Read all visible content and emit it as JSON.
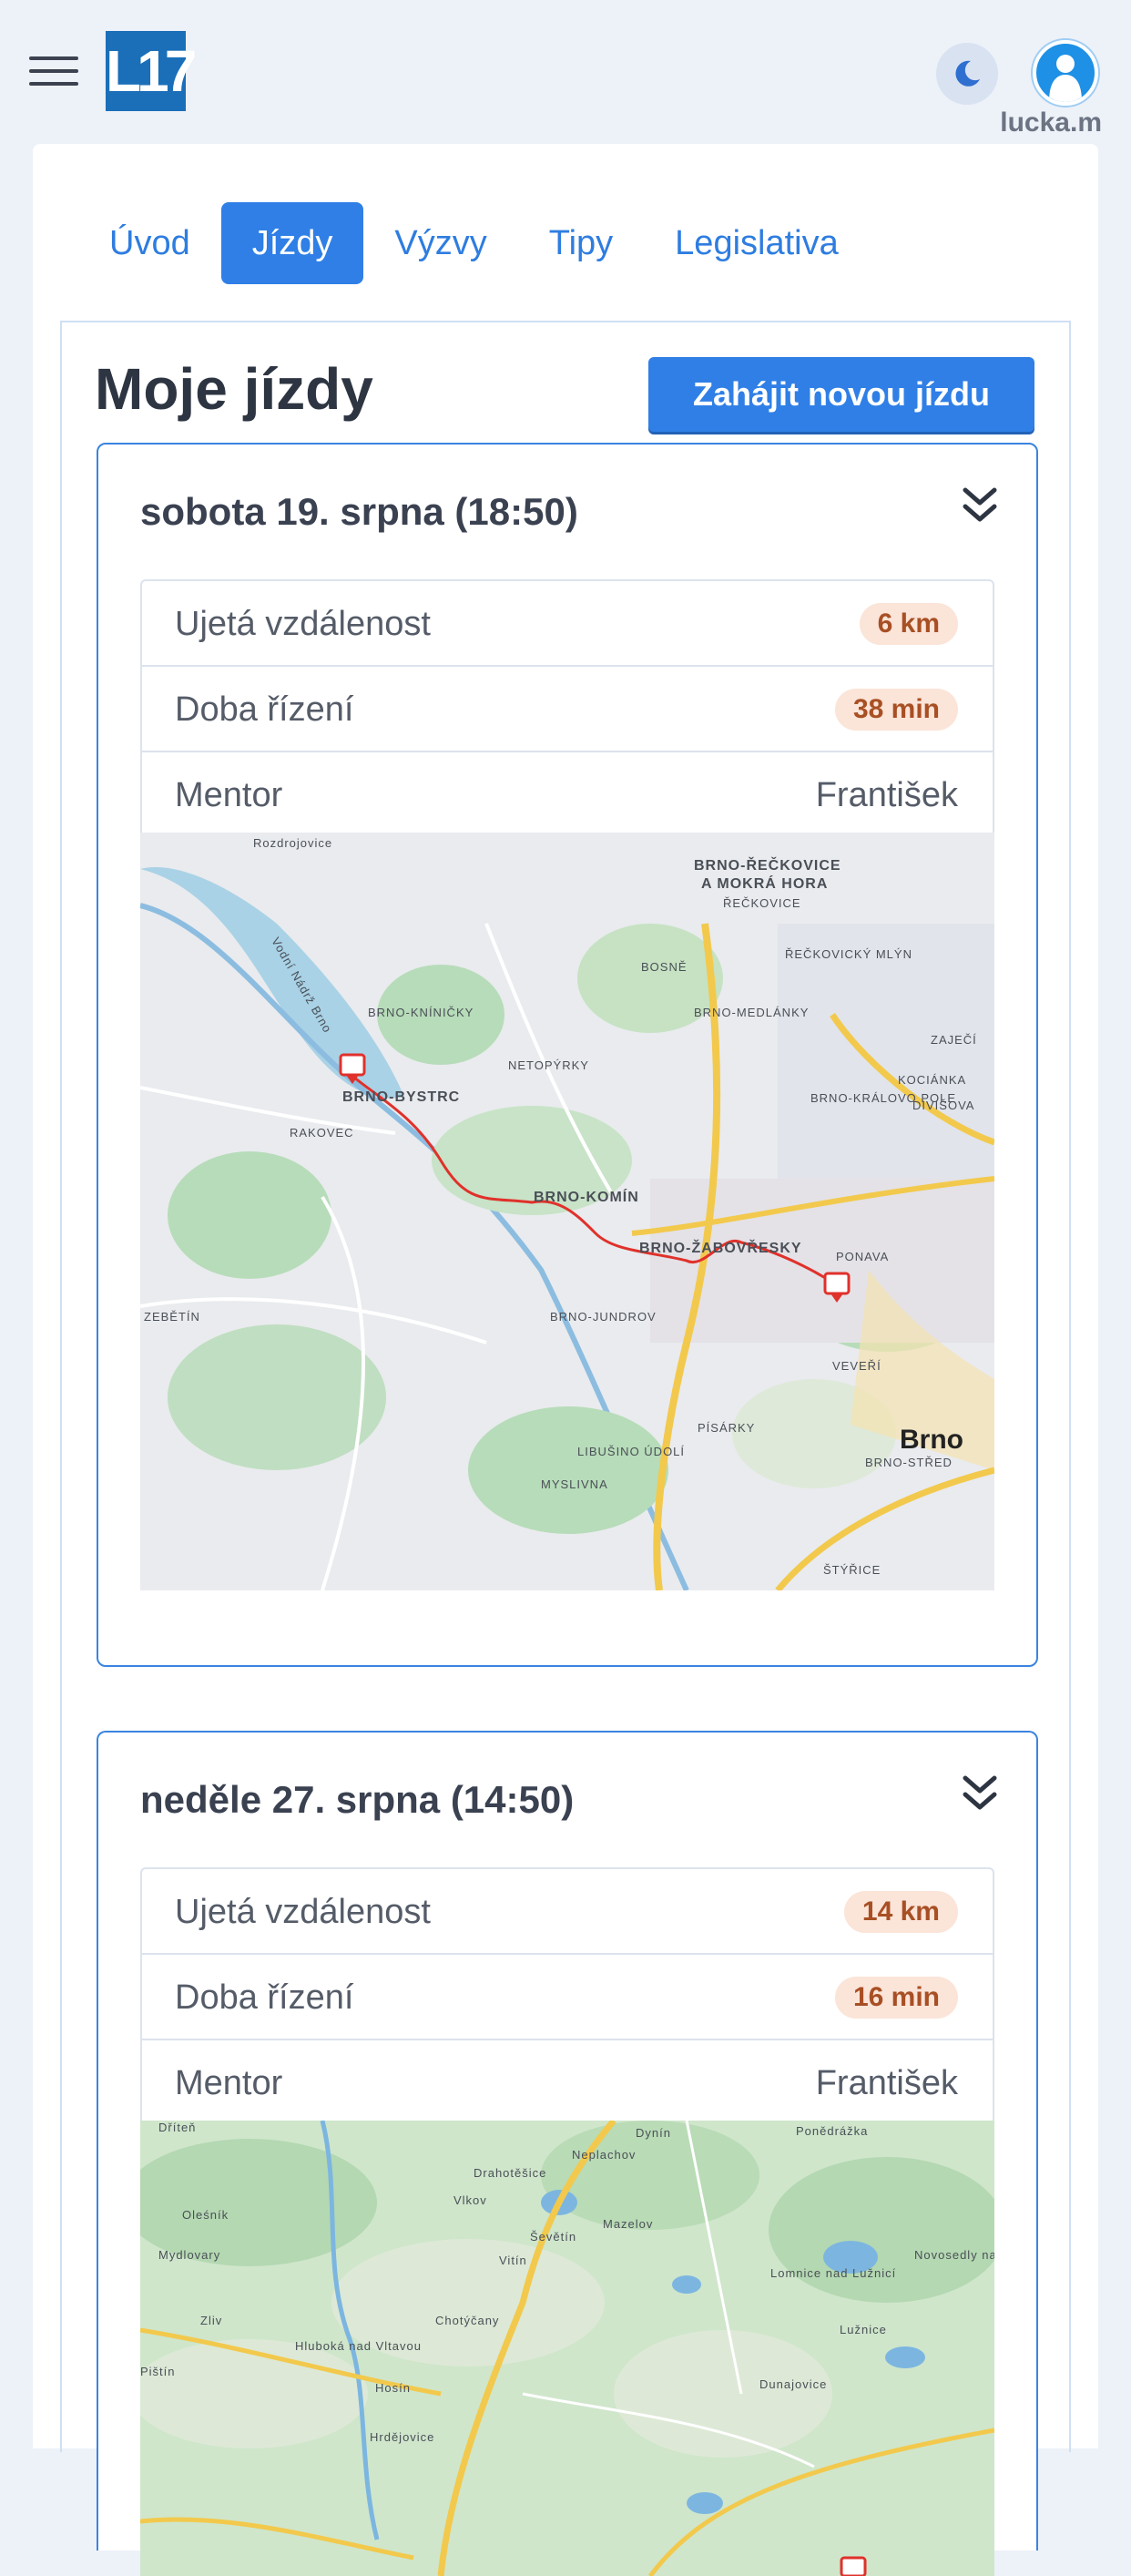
{
  "header": {
    "logo_text": "L17",
    "username": "lucka.m",
    "icons": [
      "menu-icon",
      "moon-icon",
      "user-icon"
    ]
  },
  "tabs": [
    {
      "label": "Úvod",
      "active": false
    },
    {
      "label": "Jízdy",
      "active": true
    },
    {
      "label": "Výzvy",
      "active": false
    },
    {
      "label": "Tipy",
      "active": false
    },
    {
      "label": "Legislativa",
      "active": false
    }
  ],
  "page": {
    "title": "Moje jízdy",
    "new_ride_button": "Zahájit novou jízdu"
  },
  "rides": [
    {
      "title": "sobota 19. srpna (18:50)",
      "distance_label": "Ujetá vzdálenost",
      "distance_value": "6 km",
      "duration_label": "Doba řízení",
      "duration_value": "38 min",
      "mentor_label": "Mentor",
      "mentor_value": "František",
      "map_labels": [
        "Rozdrojovice",
        "BRNO-ŘEČKOVICE",
        "A MOKRÁ HORA",
        "ŘEČKOVICE",
        "BOSNĚ",
        "ŘEČKOVICKÝ MLÝN",
        "BRNO-KNÍNIČKY",
        "BRNO-MEDLÁNKY",
        "ZAJEČÍ",
        "NETOPÝRKY",
        "KOCIÁNKA",
        "BRNO-KRÁLOVO POLE",
        "DIVIŠOVA",
        "BRNO-BYSTRC",
        "RAKOVEC",
        "BRNO-KOMÍN",
        "BRNO-ŽABOVŘESKY",
        "PONAVA",
        "ZEBĚTÍN",
        "BRNO-JUNDROV",
        "VEVEŘÍ",
        "PÍSÁRKY",
        "LIBUŠINO ÚDOLÍ",
        "Brno",
        "BRNO-STŘED",
        "MYSLIVNA",
        "ŠTÝŘICE",
        "Vodní Nádrž Brno"
      ]
    },
    {
      "title": "neděle 27. srpna (14:50)",
      "distance_label": "Ujetá vzdálenost",
      "distance_value": "14 km",
      "duration_label": "Doba řízení",
      "duration_value": "16 min",
      "mentor_label": "Mentor",
      "mentor_value": "František",
      "map_labels": [
        "Dynín",
        "Ponědrážka",
        "Dříteň",
        "Neplachov",
        "Drahotěšice",
        "Vlkov",
        "Ševětín",
        "Mazelov",
        "Oleśník",
        "Mydlovary",
        "Vitín",
        "Lomnice nad Lužnicí",
        "Novosedly nad Nežárkou",
        "Chotýčany",
        "Zliv",
        "Hluboká nad Vltavou",
        "Lužnice",
        "Pištín",
        "Hosín",
        "Dunajovice",
        "Hrdějovice"
      ]
    }
  ],
  "colors": {
    "accent": "#2f7fe6",
    "badge_bg": "#fbe4d8",
    "badge_text": "#a84f24",
    "route": "#e0312b"
  }
}
